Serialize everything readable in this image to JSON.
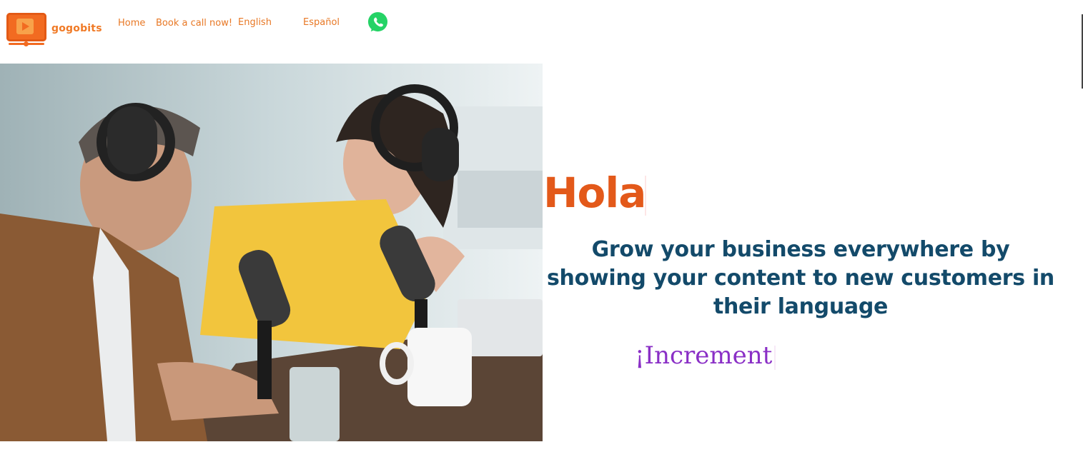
{
  "brand": {
    "name": "gogobits"
  },
  "nav": {
    "home": "Home",
    "book": "Book a call now!",
    "english": "English",
    "espanol": "Español"
  },
  "hero": {
    "greeting": "Hola",
    "tagline": "Grow your business everywhere by showing your content to new customers in their language",
    "typed_word": "¡Increment"
  },
  "colors": {
    "brand_orange": "#f26b21",
    "nav_orange": "#e87825",
    "greeting_orange": "#e3591a",
    "tagline_navy": "#134a6a",
    "typed_purple": "#8a2fc6",
    "whatsapp_green": "#25d366"
  },
  "icons": {
    "whatsapp": "whatsapp-icon",
    "logo": "play-icon"
  }
}
